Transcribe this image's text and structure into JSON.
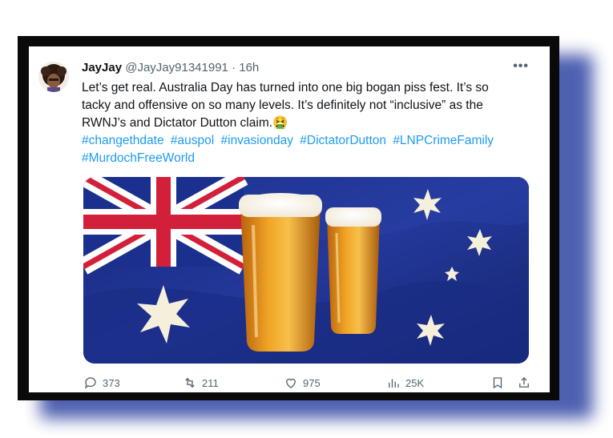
{
  "tweet": {
    "display_name": "JayJay",
    "handle": "@JayJay91341991",
    "separator": "·",
    "time": "16h",
    "more_icon": "more-horizontal-icon",
    "text_line1": "Let’s get real. Australia Day has turned into one big bogan piss fest. It’s so",
    "text_line2": "tacky and offensive on so many levels. It’s definitely not “inclusive” as the",
    "text_line3": "RWNJ’s and Dictator Dutton claim.",
    "emoji": "🤮",
    "hashtags": [
      "#changethdate",
      "#auspol",
      "#invasionday",
      "#DictatorDutton",
      "#LNPCrimeFamily",
      "#MurdochFreeWorld"
    ]
  },
  "media": {
    "description_icon": "australian-flag-beer-image"
  },
  "actions": {
    "replies": "373",
    "retweets": "211",
    "likes": "975",
    "views": "25K"
  },
  "colors": {
    "link": "#1d9bf0",
    "text": "#0f1419",
    "secondary": "#536471",
    "frame": "#0a0a0a",
    "shadow": "#3b4fa8"
  }
}
